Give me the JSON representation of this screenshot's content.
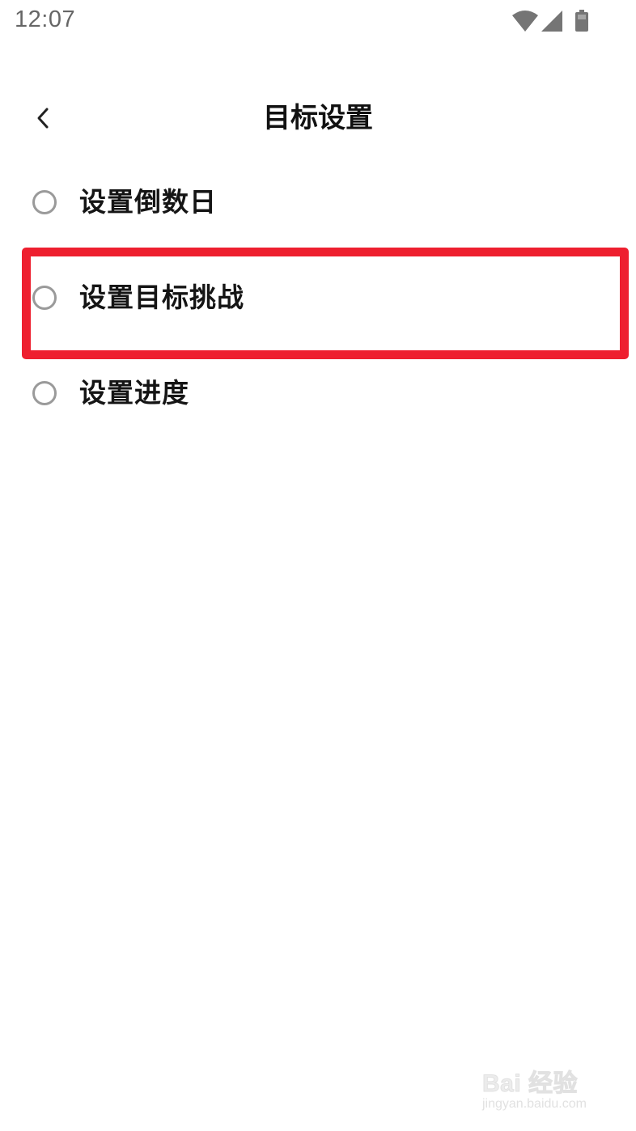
{
  "status_bar": {
    "time": "12:07",
    "icons": [
      "wifi-icon",
      "signal-icon",
      "battery-icon"
    ]
  },
  "header": {
    "back_icon": "chevron-left-icon",
    "title": "目标设置"
  },
  "options": [
    {
      "label": "设置倒数日",
      "selected": false
    },
    {
      "label": "设置目标挑战",
      "selected": false,
      "highlighted": true
    },
    {
      "label": "设置进度",
      "selected": false
    }
  ],
  "annotation": {
    "highlight_color": "#ee1f2f"
  },
  "watermark": {
    "brand": "Bai 经验",
    "url": "jingyan.baidu.com"
  }
}
